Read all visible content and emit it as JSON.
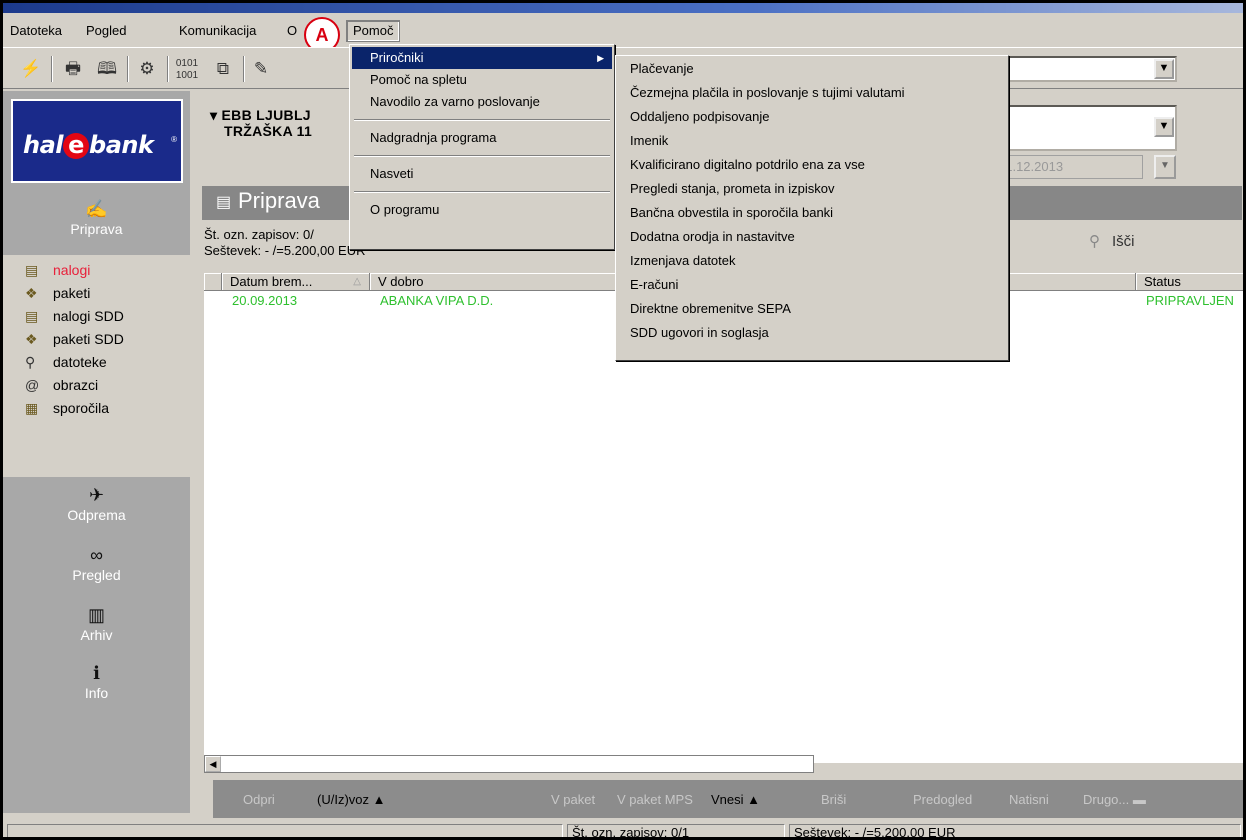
{
  "menubar": {
    "items": [
      "Datoteka",
      "Pogled",
      "Komunikacija",
      "O",
      "Pomoč"
    ],
    "callout": "A"
  },
  "help_menu": {
    "items": [
      "Priročniki",
      "Pomoč na spletu",
      "Navodilo za varno poslovanje",
      "Nadgradnja programa",
      "Nasveti",
      "O programu"
    ]
  },
  "prirocniki_submenu": {
    "items": [
      "Plačevanje",
      "Čezmejna plačila in poslovanje s tujimi valutami",
      "Oddaljeno podpisovanje",
      "Imenik",
      "Kvalificirano digitalno potdrilo ena za vse",
      "Pregledi stanja, prometa in izpiskov",
      "Bančna obvestila in sporočila banki",
      "Dodatna orodja in nastavitve",
      "Izmenjava datotek",
      "E-računi",
      "Direktne obremenitve SEPA",
      "SDD ugovori in soglasja"
    ]
  },
  "toolbar": {
    "date_value": "31.12.2013"
  },
  "sidebar": {
    "logo_text_left": "hal",
    "logo_e": "e",
    "logo_text_right": "bank",
    "logo_tm": "®",
    "priprava_label": "Priprava",
    "items": [
      "nalogi",
      "paketi",
      "nalogi SDD",
      "paketi SDD",
      "datoteke",
      "obrazci",
      "sporočila"
    ],
    "sections": [
      "Odprema",
      "Pregled",
      "Arhiv",
      "Info"
    ]
  },
  "main": {
    "bank_line1": "EBB LJUBLJ",
    "bank_line2": "TRŽAŠKA 11",
    "title": "Priprava",
    "record_count": "Št. ozn. zapisov: 0/",
    "total": "Seštevek: - /=5.200,00 EUR",
    "search_label": "Išči",
    "columns": [
      "Datum brem...",
      "V dobro",
      "Status"
    ],
    "rows": [
      {
        "date": "20.09.2013",
        "credit": "ABANKA VIPA D.D.",
        "status": "PRIPRAVLJEN"
      }
    ]
  },
  "actions": {
    "odpri": "Odpri",
    "uizvoz": "(U/Iz)voz ▲",
    "vpaket": "V paket",
    "vpaketmps": "V paket MPS",
    "vnesi": "Vnesi ▲",
    "brisi": "Briši",
    "predogled": "Predogled",
    "natisni": "Natisni",
    "drugo": "Drugo... ▬"
  },
  "statusbar": {
    "count": "Št. ozn. zapisov: 0/1",
    "total": "Seštevek: - /=5.200,00 EUR"
  }
}
